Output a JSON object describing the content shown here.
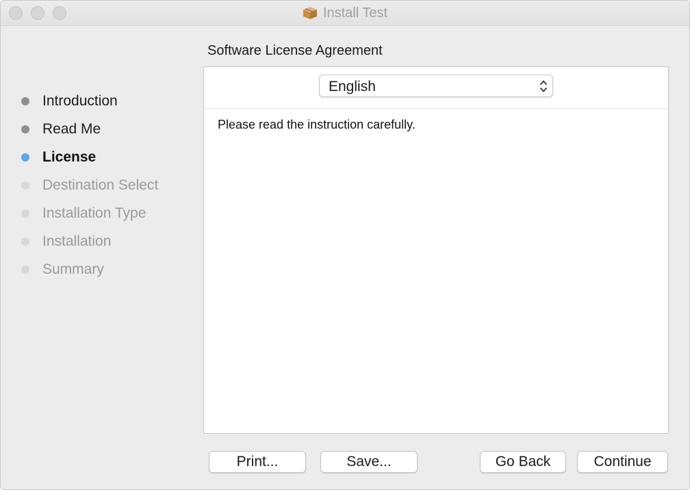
{
  "window": {
    "title": "Install Test",
    "icon": "package-icon"
  },
  "sidebar": {
    "steps": [
      {
        "label": "Introduction",
        "state": "done"
      },
      {
        "label": "Read Me",
        "state": "done"
      },
      {
        "label": "License",
        "state": "current"
      },
      {
        "label": "Destination Select",
        "state": "pending"
      },
      {
        "label": "Installation Type",
        "state": "pending"
      },
      {
        "label": "Installation",
        "state": "pending"
      },
      {
        "label": "Summary",
        "state": "pending"
      }
    ]
  },
  "main": {
    "heading": "Software License Agreement",
    "language_select": {
      "value": "English"
    },
    "license_text": "Please read the instruction carefully."
  },
  "buttons": {
    "print": "Print...",
    "save": "Save...",
    "go_back": "Go Back",
    "continue": "Continue"
  },
  "colors": {
    "current_step": "#5aa8ef",
    "done_step": "#8e8e8e",
    "pending_step": "#d8d8d8",
    "window_background": "#ececec"
  }
}
